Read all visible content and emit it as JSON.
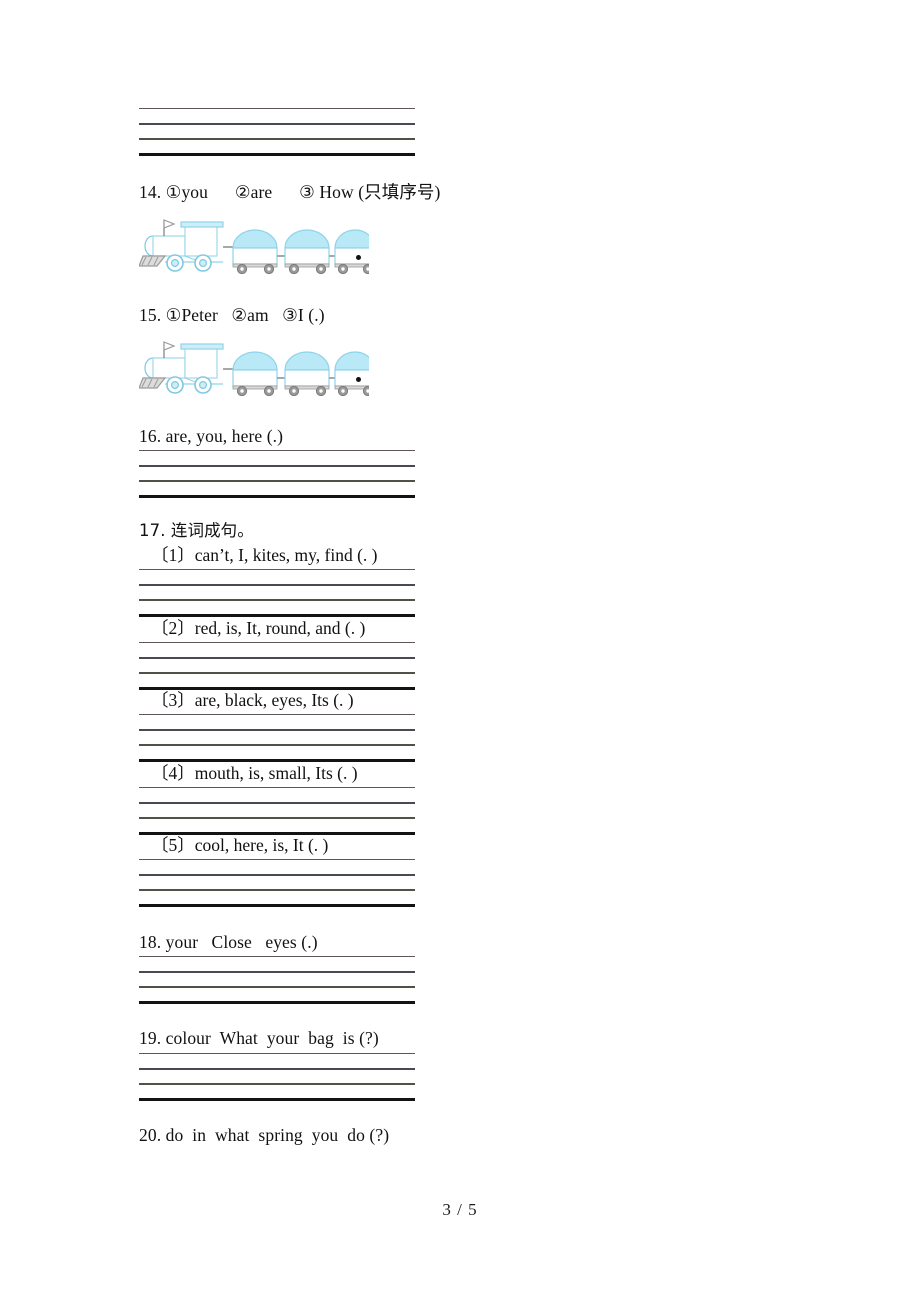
{
  "document": {
    "page_label": "3 / 5",
    "language": "en-zh",
    "colors": {
      "rule_dark": "#131313",
      "rule_mid": "#4a4a52",
      "train_fill": "#b9e9f7",
      "train_stroke": "#7ec8e3",
      "wheel_gray": "#9a9a9a",
      "text": "#111111"
    }
  },
  "questions": [
    {
      "id": "q13-rules",
      "kind": "rules_only"
    },
    {
      "id": "q14",
      "number": "14.",
      "tokens": [
        {
          "mark": "①",
          "word": "you"
        },
        {
          "mark": "②",
          "word": "are"
        },
        {
          "mark": "③",
          "word": "How"
        }
      ],
      "line": "14. ①you      ②are      ③ How (只填序号)",
      "note": "(只填序号)",
      "illustration": "train-icon"
    },
    {
      "id": "q15",
      "number": "15.",
      "tokens": [
        {
          "mark": "①",
          "word": "Peter"
        },
        {
          "mark": "②",
          "word": "am"
        },
        {
          "mark": "③",
          "word": "I"
        }
      ],
      "line": "15. ①Peter   ②am   ③I (.)",
      "punct": "(.)",
      "illustration": "train-icon"
    },
    {
      "id": "q16",
      "number": "16.",
      "line": "16. are, you, here (.)"
    },
    {
      "id": "q17",
      "number": "17.",
      "line": "17. 连词成句。",
      "subitems": [
        {
          "label": "〔1〕",
          "line": "〔1〕can’t, I, kites, my, find (. )"
        },
        {
          "label": "〔2〕",
          "line": "〔2〕red, is, It, round, and (. )"
        },
        {
          "label": "〔3〕",
          "line": "〔3〕are, black, eyes, Its (. )"
        },
        {
          "label": "〔4〕",
          "line": "〔4〕mouth, is, small, Its (. )"
        },
        {
          "label": "〔5〕",
          "line": "〔5〕cool, here, is, It (. )"
        }
      ]
    },
    {
      "id": "q18",
      "number": "18.",
      "line": "18. your   Close   eyes (.)"
    },
    {
      "id": "q19",
      "number": "19.",
      "line": "19. colour  What  your  bag  is (?)"
    },
    {
      "id": "q20",
      "number": "20.",
      "line": "20. do  in  what  spring  you  do (?)"
    }
  ]
}
